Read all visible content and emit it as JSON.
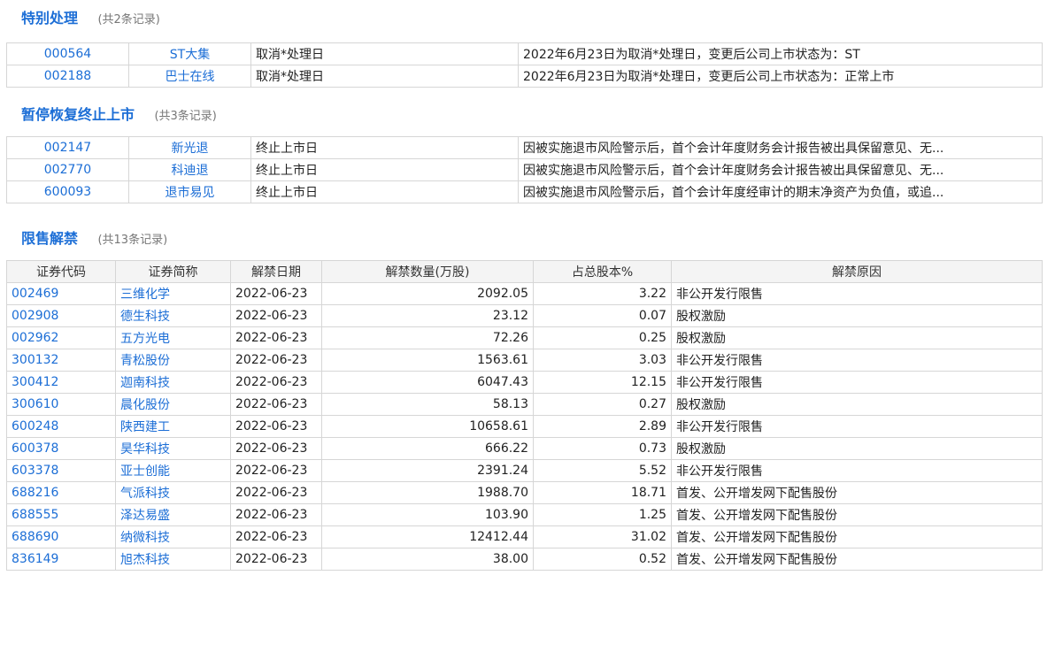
{
  "special": {
    "title": "特别处理",
    "count": "(共2条记录)",
    "rows": [
      {
        "code": "000564",
        "name": "ST大集",
        "type": "取消*处理日",
        "desc": "2022年6月23日为取消*处理日，变更后公司上市状态为：ST"
      },
      {
        "code": "002188",
        "name": "巴士在线",
        "type": "取消*处理日",
        "desc": "2022年6月23日为取消*处理日，变更后公司上市状态为：正常上市"
      }
    ]
  },
  "suspend": {
    "title": "暂停恢复终止上市",
    "count": "(共3条记录)",
    "rows": [
      {
        "code": "002147",
        "name": "新光退",
        "type": "终止上市日",
        "desc": "因被实施退市风险警示后，首个会计年度财务会计报告被出具保留意见、无..."
      },
      {
        "code": "002770",
        "name": "科迪退",
        "type": "终止上市日",
        "desc": "因被实施退市风险警示后，首个会计年度财务会计报告被出具保留意见、无..."
      },
      {
        "code": "600093",
        "name": "退市易见",
        "type": "终止上市日",
        "desc": "因被实施退市风险警示后，首个会计年度经审计的期末净资产为负值，或追..."
      }
    ]
  },
  "unlock": {
    "title": "限售解禁",
    "count": "(共13条记录)",
    "headers": [
      "证券代码",
      "证券简称",
      "解禁日期",
      "解禁数量(万股)",
      "占总股本%",
      "解禁原因"
    ],
    "rows": [
      {
        "code": "002469",
        "name": "三维化学",
        "date": "2022-06-23",
        "qty": "2092.05",
        "pct": "3.22",
        "reason": "非公开发行限售"
      },
      {
        "code": "002908",
        "name": "德生科技",
        "date": "2022-06-23",
        "qty": "23.12",
        "pct": "0.07",
        "reason": "股权激励"
      },
      {
        "code": "002962",
        "name": "五方光电",
        "date": "2022-06-23",
        "qty": "72.26",
        "pct": "0.25",
        "reason": "股权激励"
      },
      {
        "code": "300132",
        "name": "青松股份",
        "date": "2022-06-23",
        "qty": "1563.61",
        "pct": "3.03",
        "reason": "非公开发行限售"
      },
      {
        "code": "300412",
        "name": "迦南科技",
        "date": "2022-06-23",
        "qty": "6047.43",
        "pct": "12.15",
        "reason": "非公开发行限售"
      },
      {
        "code": "300610",
        "name": "晨化股份",
        "date": "2022-06-23",
        "qty": "58.13",
        "pct": "0.27",
        "reason": "股权激励"
      },
      {
        "code": "600248",
        "name": "陕西建工",
        "date": "2022-06-23",
        "qty": "10658.61",
        "pct": "2.89",
        "reason": "非公开发行限售"
      },
      {
        "code": "600378",
        "name": "昊华科技",
        "date": "2022-06-23",
        "qty": "666.22",
        "pct": "0.73",
        "reason": "股权激励"
      },
      {
        "code": "603378",
        "name": "亚士创能",
        "date": "2022-06-23",
        "qty": "2391.24",
        "pct": "5.52",
        "reason": "非公开发行限售"
      },
      {
        "code": "688216",
        "name": "气派科技",
        "date": "2022-06-23",
        "qty": "1988.70",
        "pct": "18.71",
        "reason": "首发、公开增发网下配售股份"
      },
      {
        "code": "688555",
        "name": "泽达易盛",
        "date": "2022-06-23",
        "qty": "103.90",
        "pct": "1.25",
        "reason": "首发、公开增发网下配售股份"
      },
      {
        "code": "688690",
        "name": "纳微科技",
        "date": "2022-06-23",
        "qty": "12412.44",
        "pct": "31.02",
        "reason": "首发、公开增发网下配售股份"
      },
      {
        "code": "836149",
        "name": "旭杰科技",
        "date": "2022-06-23",
        "qty": "38.00",
        "pct": "0.52",
        "reason": "首发、公开增发网下配售股份"
      }
    ]
  }
}
